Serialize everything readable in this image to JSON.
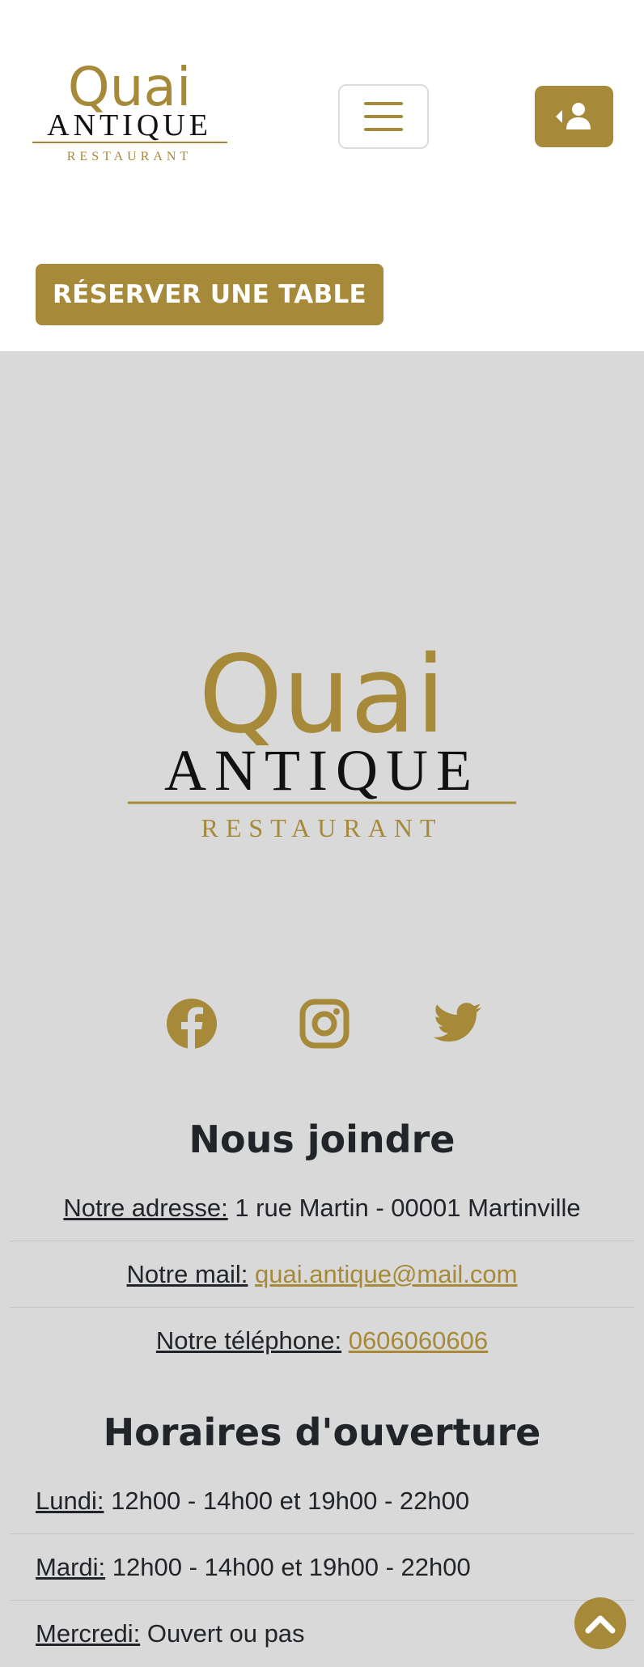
{
  "brand": {
    "name_top": "Quai",
    "name_main": "ANTIQUE",
    "name_sub": "RESTAURANT",
    "color": "#a68a39"
  },
  "header": {
    "menu_icon": "hamburger-icon",
    "user_icon": "user-arrow-icon",
    "reserve_label": "RÉSERVER UNE TABLE"
  },
  "footer": {
    "socials": [
      {
        "icon": "facebook-icon"
      },
      {
        "icon": "instagram-icon"
      },
      {
        "icon": "twitter-icon"
      }
    ],
    "contact": {
      "title": "Nous joindre",
      "address_label": "Notre adresse:",
      "address_value": "1 rue Martin - 00001 Martinville",
      "mail_label": "Notre mail:",
      "mail_value": "quai.antique@mail.com",
      "phone_label": "Notre téléphone:",
      "phone_value": "0606060606"
    },
    "hours": {
      "title": "Horaires d'ouverture",
      "days": [
        {
          "day": "Lundi:",
          "value": "12h00 - 14h00 et 19h00 - 22h00"
        },
        {
          "day": "Mardi:",
          "value": "12h00 - 14h00 et 19h00 - 22h00"
        },
        {
          "day": "Mercredi:",
          "value": "Ouvert ou pas"
        }
      ]
    },
    "to_top_icon": "chevron-up-icon"
  }
}
